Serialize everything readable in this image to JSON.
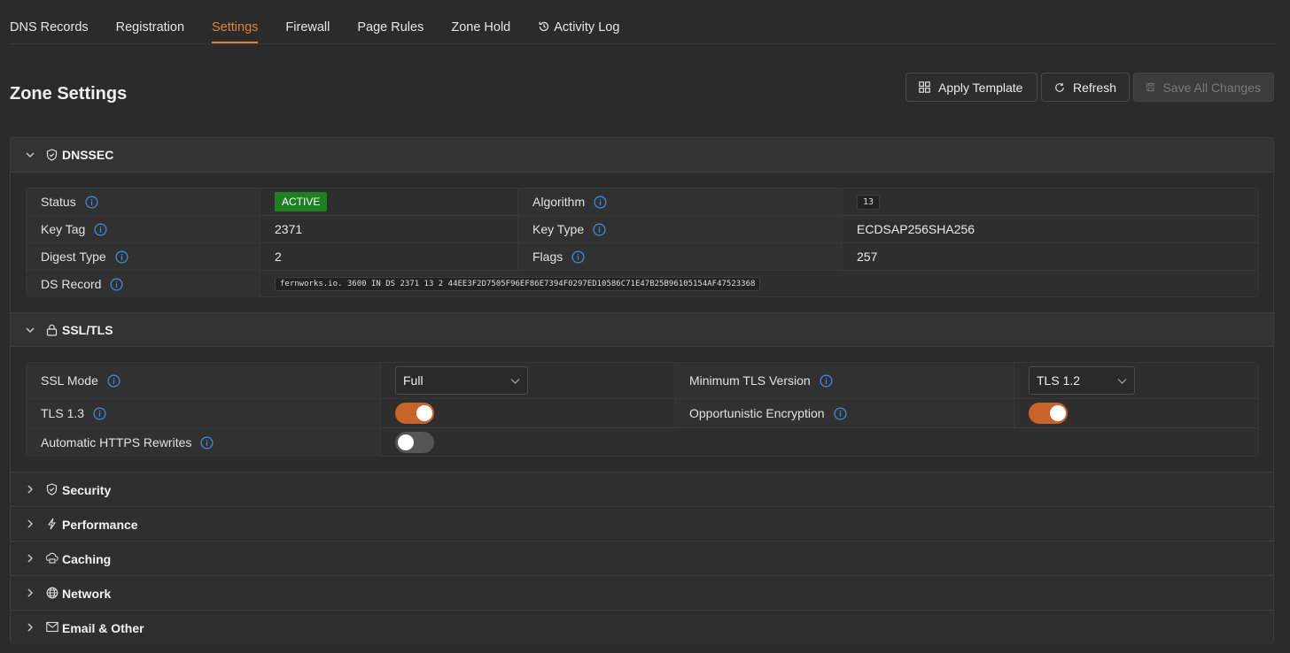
{
  "tabs": [
    {
      "label": "DNS Records",
      "active": false
    },
    {
      "label": "Registration",
      "active": false
    },
    {
      "label": "Settings",
      "active": true
    },
    {
      "label": "Firewall",
      "active": false
    },
    {
      "label": "Page Rules",
      "active": false
    },
    {
      "label": "Zone Hold",
      "active": false
    },
    {
      "label": "Activity Log",
      "active": false,
      "icon": "history-icon"
    }
  ],
  "page_title": "Zone Settings",
  "toolbar": {
    "apply_template": "Apply Template",
    "refresh": "Refresh",
    "save_all": "Save All Changes"
  },
  "dnssec": {
    "title": "DNSSEC",
    "status_label": "Status",
    "status_value": "ACTIVE",
    "algorithm_label": "Algorithm",
    "algorithm_value": "13",
    "key_tag_label": "Key Tag",
    "key_tag_value": "2371",
    "key_type_label": "Key Type",
    "key_type_value": "ECDSAP256SHA256",
    "digest_type_label": "Digest Type",
    "digest_type_value": "2",
    "flags_label": "Flags",
    "flags_value": "257",
    "ds_record_label": "DS Record",
    "ds_record_value": "fernworks.io. 3600 IN DS 2371 13 2 44EE3F2D7505F96EF86E7394F0297ED10586C71E47B25B96105154AF47523368"
  },
  "ssl": {
    "title": "SSL/TLS",
    "ssl_mode_label": "SSL Mode",
    "ssl_mode_value": "Full",
    "min_tls_label": "Minimum TLS Version",
    "min_tls_value": "TLS 1.2",
    "tls13_label": "TLS 1.3",
    "tls13_on": true,
    "opportunistic_label": "Opportunistic Encryption",
    "opportunistic_on": true,
    "https_rewrites_label": "Automatic HTTPS Rewrites",
    "https_rewrites_on": false
  },
  "collapsed_sections": [
    {
      "title": "Security",
      "icon": "shield-icon"
    },
    {
      "title": "Performance",
      "icon": "lightning-icon"
    },
    {
      "title": "Caching",
      "icon": "cache-icon"
    },
    {
      "title": "Network",
      "icon": "globe-icon"
    },
    {
      "title": "Email & Other",
      "icon": "mail-icon"
    }
  ],
  "colors": {
    "accent": "#e0823f",
    "toggle_on": "#c8632a",
    "active_badge": "#1f7f23",
    "info_icon": "#3d8fe6"
  }
}
